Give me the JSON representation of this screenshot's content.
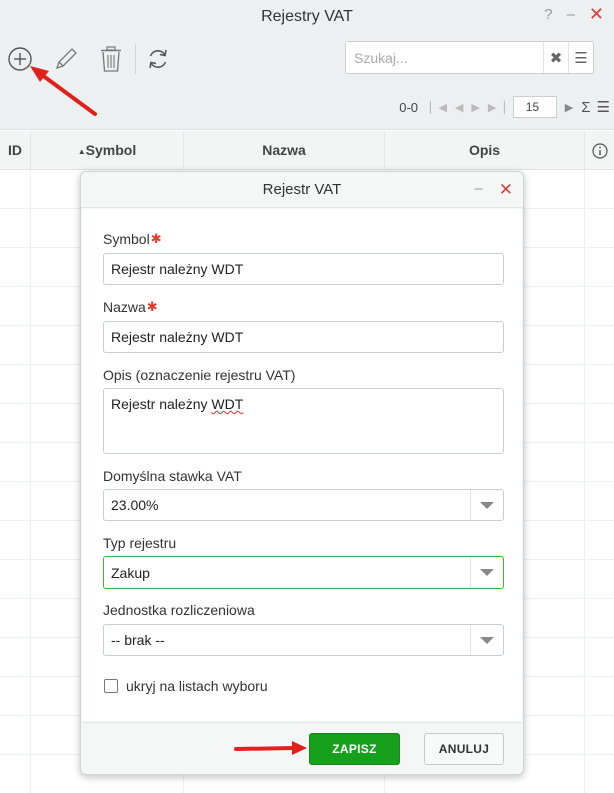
{
  "window": {
    "title": "Rejestry VAT",
    "help_label": "?",
    "minimize_label": "–",
    "close_label": "✕"
  },
  "toolbar": {
    "add_icon": "plus-circle-icon",
    "edit_icon": "pencil-icon",
    "delete_icon": "trash-icon",
    "refresh_icon": "refresh-icon"
  },
  "search": {
    "placeholder": "Szukaj...",
    "clear_label": "✖",
    "menu_label": "☰"
  },
  "pager": {
    "range": "0-0",
    "page_size": "15",
    "sum_label": "Σ",
    "menu_label": "☰"
  },
  "grid": {
    "columns": {
      "id": "ID",
      "symbol": "Symbol",
      "name": "Nazwa",
      "description": "Opis"
    },
    "sort_indicator": "▲"
  },
  "dialog": {
    "title": "Rejestr VAT",
    "minimize_label": "–",
    "close_label": "✕",
    "required_mark": "✱",
    "symbol": {
      "label": "Symbol",
      "value": "Rejestr należny WDT"
    },
    "name": {
      "label": "Nazwa",
      "value": "Rejestr należny WDT"
    },
    "description": {
      "label": "Opis (oznaczenie rejestru VAT)",
      "value_prefix": "Rejestr należny ",
      "value_spell": "WDT"
    },
    "vat_rate": {
      "label": "Domyślna stawka VAT",
      "value": "23.00%"
    },
    "register_type": {
      "label": "Typ rejestru",
      "value": "Zakup"
    },
    "settlement_unit": {
      "label": "Jednostka rozliczeniowa",
      "value": "-- brak --"
    },
    "hide_checkbox": {
      "label": "ukryj na listach wyboru",
      "checked": false
    },
    "save_label": "ZAPISZ",
    "cancel_label": "ANULUJ"
  },
  "colors": {
    "accent_green": "#16a01c",
    "close_red": "#d9403a",
    "annotation_red": "#e0201b"
  }
}
